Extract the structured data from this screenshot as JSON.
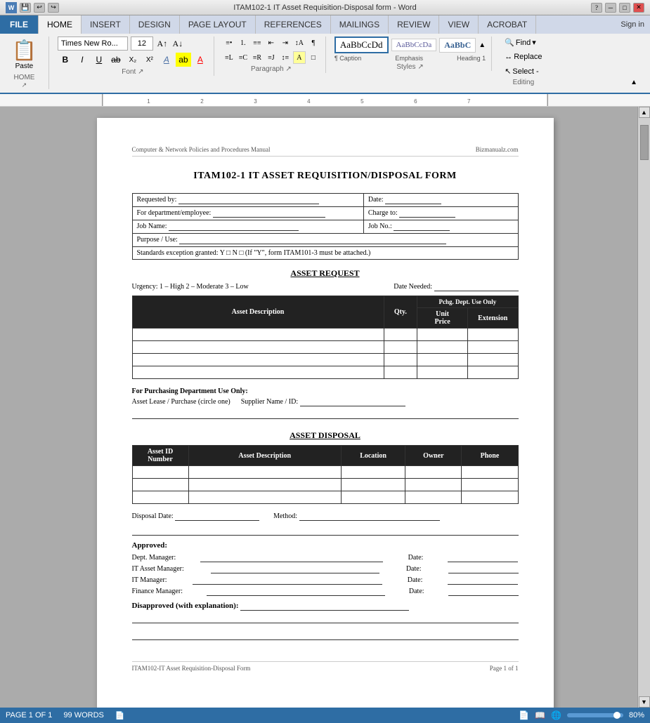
{
  "window": {
    "title": "ITAM102-1 IT Asset Requisition-Disposal form - Word",
    "controls": [
      "minimize",
      "maximize",
      "close"
    ]
  },
  "ribbon": {
    "tabs": [
      "FILE",
      "HOME",
      "INSERT",
      "DESIGN",
      "PAGE LAYOUT",
      "REFERENCES",
      "MAILINGS",
      "REVIEW",
      "VIEW",
      "ACROBAT"
    ],
    "active_tab": "HOME",
    "font_name": "Times New Ro...",
    "font_size": "12",
    "styles": [
      {
        "name": "AaBbCcDd",
        "label": "Caption"
      },
      {
        "name": "AaBbCcDa",
        "label": "Emphasis"
      },
      {
        "name": "AaBbC",
        "label": "Heading 1"
      }
    ],
    "editing": {
      "find": "Find",
      "replace": "Replace",
      "select": "Select -"
    }
  },
  "page": {
    "header_left": "Computer & Network Policies and Procedures Manual",
    "header_right": "Bizmanualz.com",
    "title": "ITAM102-1   IT ASSET REQUISITION/DISPOSAL FORM",
    "info_section": {
      "requested_by_label": "Requested by:",
      "date_label": "Date:",
      "for_department_label": "For department/employee:",
      "charge_to_label": "Charge to:",
      "job_name_label": "Job Name:",
      "job_no_label": "Job No.:",
      "purpose_label": "Purpose / Use:",
      "standards_label": "Standards exception granted: Y □ N □  (If \"Y\", form ITAM101-3 must be attached.)"
    },
    "asset_request": {
      "section_title": "ASSET REQUEST",
      "urgency_text": "Urgency:   1 – High    2 – Moderate    3 – Low",
      "date_needed_label": "Date Needed:",
      "pchg_label": "Pchg. Dept. Use Only",
      "table_headers": [
        "Asset Description",
        "Qty.",
        "Unit\nPrice",
        "Extension"
      ],
      "empty_rows": 4
    },
    "purchasing": {
      "title": "For Purchasing Department Use Only:",
      "lease_purchase_label": "Asset Lease / Purchase (circle one)",
      "supplier_label": "Supplier Name / ID:"
    },
    "asset_disposal": {
      "section_title": "ASSET DISPOSAL",
      "table_headers": [
        "Asset ID\nNumber",
        "Asset Description",
        "Location",
        "Owner",
        "Phone"
      ],
      "empty_rows": 3,
      "disposal_date_label": "Disposal Date:",
      "method_label": "Method:"
    },
    "approvals": {
      "approved_label": "Approved:",
      "dept_manager_label": "Dept. Manager:",
      "date_label": "Date:",
      "it_asset_manager_label": "IT Asset Manager:",
      "it_manager_label": "IT Manager:",
      "finance_manager_label": "Finance Manager:",
      "disapproved_label": "Disapproved (with explanation):"
    },
    "footer_left": "ITAM102-IT Asset Requisition-Disposal Form",
    "footer_right": "Page 1 of 1"
  },
  "status_bar": {
    "page_info": "PAGE 1 OF 1",
    "words": "99 WORDS",
    "zoom_percent": "80%"
  }
}
